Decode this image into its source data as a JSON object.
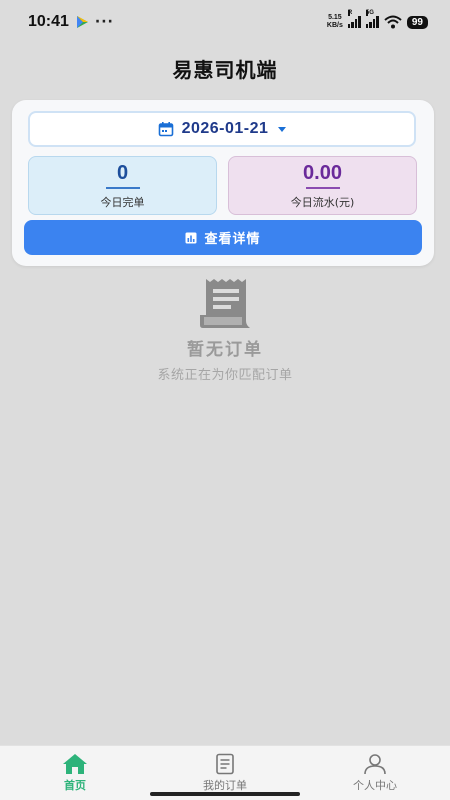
{
  "status_bar": {
    "time": "10:41",
    "more": "···",
    "net_speed_value": "5.15",
    "net_speed_unit": "KB/s",
    "sim1_tag": "R",
    "sim2_tag": "5G",
    "battery": "99",
    "icons": [
      "play-store-icon",
      "signal-icon",
      "wifi-icon",
      "battery-icon"
    ]
  },
  "header": {
    "title": "易惠司机端"
  },
  "summary": {
    "date": "2026-01-21",
    "completed_value": "0",
    "completed_label": "今日完单",
    "revenue_value": "0.00",
    "revenue_label": "今日流水(元)",
    "detail_button": "查看详情"
  },
  "empty_state": {
    "title": "暂无订单",
    "subtitle": "系统正在为你匹配订单"
  },
  "tabs": [
    {
      "label": "首页",
      "icon": "home-icon",
      "active": true
    },
    {
      "label": "我的订单",
      "icon": "orders-icon",
      "active": false
    },
    {
      "label": "个人中心",
      "icon": "profile-icon",
      "active": false
    }
  ],
  "colors": {
    "page_bg": "#dcdcdc",
    "primary_button": "#3b83f0",
    "active_tab": "#2db37a",
    "completed_box": "#dceef9",
    "revenue_box": "#efe0ef"
  }
}
